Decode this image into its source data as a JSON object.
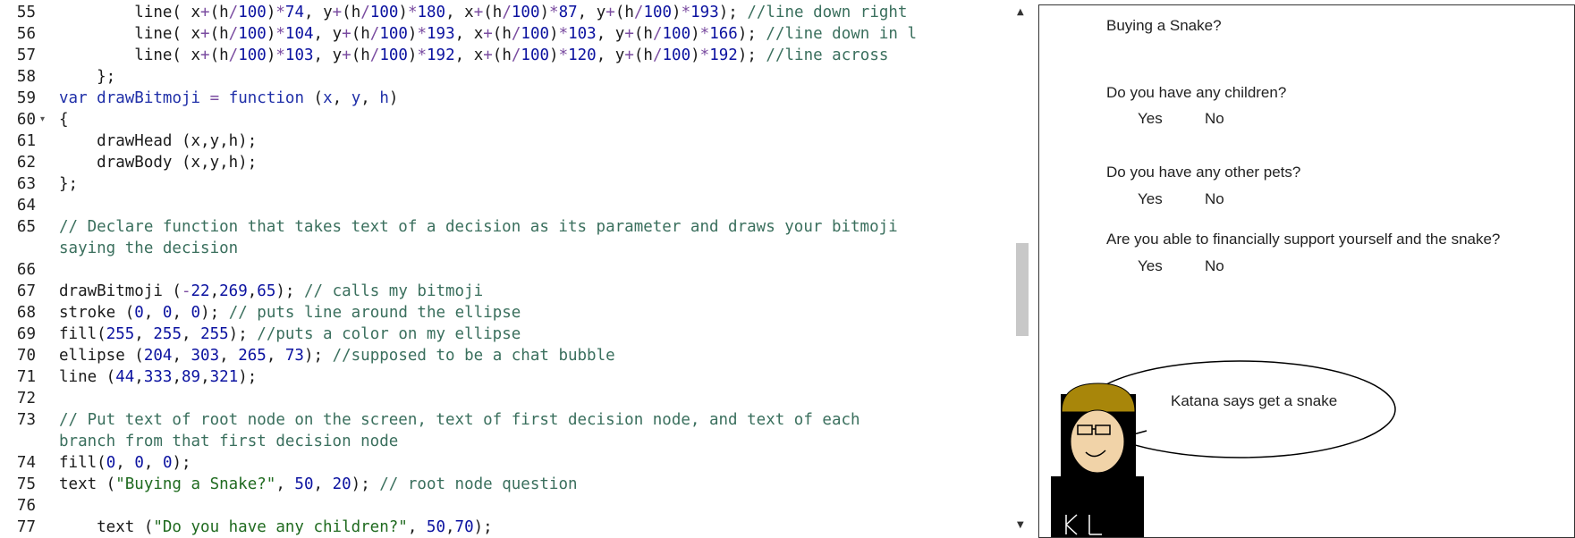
{
  "editor": {
    "lines": [
      {
        "n": "55",
        "fold": "",
        "tokens": [
          {
            "c": "",
            "t": "        line( x"
          },
          {
            "c": "op",
            "t": "+"
          },
          {
            "c": "",
            "t": "(h"
          },
          {
            "c": "op",
            "t": "/"
          },
          {
            "c": "num",
            "t": "100"
          },
          {
            "c": "",
            "t": ")"
          },
          {
            "c": "op",
            "t": "*"
          },
          {
            "c": "num",
            "t": "74"
          },
          {
            "c": "",
            "t": ", y"
          },
          {
            "c": "op",
            "t": "+"
          },
          {
            "c": "",
            "t": "(h"
          },
          {
            "c": "op",
            "t": "/"
          },
          {
            "c": "num",
            "t": "100"
          },
          {
            "c": "",
            "t": ")"
          },
          {
            "c": "op",
            "t": "*"
          },
          {
            "c": "num",
            "t": "180"
          },
          {
            "c": "",
            "t": ", x"
          },
          {
            "c": "op",
            "t": "+"
          },
          {
            "c": "",
            "t": "(h"
          },
          {
            "c": "op",
            "t": "/"
          },
          {
            "c": "num",
            "t": "100"
          },
          {
            "c": "",
            "t": ")"
          },
          {
            "c": "op",
            "t": "*"
          },
          {
            "c": "num",
            "t": "87"
          },
          {
            "c": "",
            "t": ", y"
          },
          {
            "c": "op",
            "t": "+"
          },
          {
            "c": "",
            "t": "(h"
          },
          {
            "c": "op",
            "t": "/"
          },
          {
            "c": "num",
            "t": "100"
          },
          {
            "c": "",
            "t": ")"
          },
          {
            "c": "op",
            "t": "*"
          },
          {
            "c": "num",
            "t": "193"
          },
          {
            "c": "",
            "t": "); "
          },
          {
            "c": "cm",
            "t": "//line down right"
          }
        ]
      },
      {
        "n": "56",
        "fold": "",
        "tokens": [
          {
            "c": "",
            "t": "        line( x"
          },
          {
            "c": "op",
            "t": "+"
          },
          {
            "c": "",
            "t": "(h"
          },
          {
            "c": "op",
            "t": "/"
          },
          {
            "c": "num",
            "t": "100"
          },
          {
            "c": "",
            "t": ")"
          },
          {
            "c": "op",
            "t": "*"
          },
          {
            "c": "num",
            "t": "104"
          },
          {
            "c": "",
            "t": ", y"
          },
          {
            "c": "op",
            "t": "+"
          },
          {
            "c": "",
            "t": "(h"
          },
          {
            "c": "op",
            "t": "/"
          },
          {
            "c": "num",
            "t": "100"
          },
          {
            "c": "",
            "t": ")"
          },
          {
            "c": "op",
            "t": "*"
          },
          {
            "c": "num",
            "t": "193"
          },
          {
            "c": "",
            "t": ", x"
          },
          {
            "c": "op",
            "t": "+"
          },
          {
            "c": "",
            "t": "(h"
          },
          {
            "c": "op",
            "t": "/"
          },
          {
            "c": "num",
            "t": "100"
          },
          {
            "c": "",
            "t": ")"
          },
          {
            "c": "op",
            "t": "*"
          },
          {
            "c": "num",
            "t": "103"
          },
          {
            "c": "",
            "t": ", y"
          },
          {
            "c": "op",
            "t": "+"
          },
          {
            "c": "",
            "t": "(h"
          },
          {
            "c": "op",
            "t": "/"
          },
          {
            "c": "num",
            "t": "100"
          },
          {
            "c": "",
            "t": ")"
          },
          {
            "c": "op",
            "t": "*"
          },
          {
            "c": "num",
            "t": "166"
          },
          {
            "c": "",
            "t": "); "
          },
          {
            "c": "cm",
            "t": "//line down in l"
          }
        ]
      },
      {
        "n": "57",
        "fold": "",
        "tokens": [
          {
            "c": "",
            "t": "        line( x"
          },
          {
            "c": "op",
            "t": "+"
          },
          {
            "c": "",
            "t": "(h"
          },
          {
            "c": "op",
            "t": "/"
          },
          {
            "c": "num",
            "t": "100"
          },
          {
            "c": "",
            "t": ")"
          },
          {
            "c": "op",
            "t": "*"
          },
          {
            "c": "num",
            "t": "103"
          },
          {
            "c": "",
            "t": ", y"
          },
          {
            "c": "op",
            "t": "+"
          },
          {
            "c": "",
            "t": "(h"
          },
          {
            "c": "op",
            "t": "/"
          },
          {
            "c": "num",
            "t": "100"
          },
          {
            "c": "",
            "t": ")"
          },
          {
            "c": "op",
            "t": "*"
          },
          {
            "c": "num",
            "t": "192"
          },
          {
            "c": "",
            "t": ", x"
          },
          {
            "c": "op",
            "t": "+"
          },
          {
            "c": "",
            "t": "(h"
          },
          {
            "c": "op",
            "t": "/"
          },
          {
            "c": "num",
            "t": "100"
          },
          {
            "c": "",
            "t": ")"
          },
          {
            "c": "op",
            "t": "*"
          },
          {
            "c": "num",
            "t": "120"
          },
          {
            "c": "",
            "t": ", y"
          },
          {
            "c": "op",
            "t": "+"
          },
          {
            "c": "",
            "t": "(h"
          },
          {
            "c": "op",
            "t": "/"
          },
          {
            "c": "num",
            "t": "100"
          },
          {
            "c": "",
            "t": ")"
          },
          {
            "c": "op",
            "t": "*"
          },
          {
            "c": "num",
            "t": "192"
          },
          {
            "c": "",
            "t": "); "
          },
          {
            "c": "cm",
            "t": "//line across"
          }
        ]
      },
      {
        "n": "58",
        "fold": "",
        "tokens": [
          {
            "c": "",
            "t": "    };"
          }
        ]
      },
      {
        "n": "59",
        "fold": "",
        "tokens": [
          {
            "c": "kw",
            "t": "var"
          },
          {
            "c": "",
            "t": " "
          },
          {
            "c": "var",
            "t": "drawBitmoji"
          },
          {
            "c": "",
            "t": " "
          },
          {
            "c": "op",
            "t": "="
          },
          {
            "c": "",
            "t": " "
          },
          {
            "c": "kw",
            "t": "function"
          },
          {
            "c": "",
            "t": " ("
          },
          {
            "c": "var",
            "t": "x"
          },
          {
            "c": "",
            "t": ", "
          },
          {
            "c": "var",
            "t": "y"
          },
          {
            "c": "",
            "t": ", "
          },
          {
            "c": "var",
            "t": "h"
          },
          {
            "c": "",
            "t": ")"
          }
        ]
      },
      {
        "n": "60",
        "fold": "▾",
        "tokens": [
          {
            "c": "",
            "t": "{"
          }
        ]
      },
      {
        "n": "61",
        "fold": "",
        "tokens": [
          {
            "c": "",
            "t": "    drawHead (x,y,h);"
          }
        ]
      },
      {
        "n": "62",
        "fold": "",
        "tokens": [
          {
            "c": "",
            "t": "    drawBody (x,y,h);"
          }
        ]
      },
      {
        "n": "63",
        "fold": "",
        "tokens": [
          {
            "c": "",
            "t": "};"
          }
        ]
      },
      {
        "n": "64",
        "fold": "",
        "tokens": []
      },
      {
        "n": "65",
        "fold": "",
        "tokens": [
          {
            "c": "cm",
            "t": "// Declare function that takes text of a decision as its parameter and draws your bitmoji"
          }
        ]
      },
      {
        "n": "",
        "fold": "",
        "tokens": [
          {
            "c": "cm",
            "t": "saying the decision"
          }
        ]
      },
      {
        "n": "66",
        "fold": "",
        "tokens": []
      },
      {
        "n": "67",
        "fold": "",
        "tokens": [
          {
            "c": "",
            "t": "drawBitmoji ("
          },
          {
            "c": "op",
            "t": "-"
          },
          {
            "c": "num",
            "t": "22"
          },
          {
            "c": "",
            "t": ","
          },
          {
            "c": "num",
            "t": "269"
          },
          {
            "c": "",
            "t": ","
          },
          {
            "c": "num",
            "t": "65"
          },
          {
            "c": "",
            "t": "); "
          },
          {
            "c": "cm",
            "t": "// calls my bitmoji"
          }
        ]
      },
      {
        "n": "68",
        "fold": "",
        "tokens": [
          {
            "c": "",
            "t": "stroke ("
          },
          {
            "c": "num",
            "t": "0"
          },
          {
            "c": "",
            "t": ", "
          },
          {
            "c": "num",
            "t": "0"
          },
          {
            "c": "",
            "t": ", "
          },
          {
            "c": "num",
            "t": "0"
          },
          {
            "c": "",
            "t": "); "
          },
          {
            "c": "cm",
            "t": "// puts line around the ellipse"
          }
        ]
      },
      {
        "n": "69",
        "fold": "",
        "tokens": [
          {
            "c": "",
            "t": "fill("
          },
          {
            "c": "num",
            "t": "255"
          },
          {
            "c": "",
            "t": ", "
          },
          {
            "c": "num",
            "t": "255"
          },
          {
            "c": "",
            "t": ", "
          },
          {
            "c": "num",
            "t": "255"
          },
          {
            "c": "",
            "t": "); "
          },
          {
            "c": "cm",
            "t": "//puts a color on my ellipse"
          }
        ]
      },
      {
        "n": "70",
        "fold": "",
        "tokens": [
          {
            "c": "",
            "t": "ellipse ("
          },
          {
            "c": "num",
            "t": "204"
          },
          {
            "c": "",
            "t": ", "
          },
          {
            "c": "num",
            "t": "303"
          },
          {
            "c": "",
            "t": ", "
          },
          {
            "c": "num",
            "t": "265"
          },
          {
            "c": "",
            "t": ", "
          },
          {
            "c": "num",
            "t": "73"
          },
          {
            "c": "",
            "t": "); "
          },
          {
            "c": "cm",
            "t": "//supposed to be a chat bubble"
          }
        ]
      },
      {
        "n": "71",
        "fold": "",
        "tokens": [
          {
            "c": "",
            "t": "line ("
          },
          {
            "c": "num",
            "t": "44"
          },
          {
            "c": "",
            "t": ","
          },
          {
            "c": "num",
            "t": "333"
          },
          {
            "c": "",
            "t": ","
          },
          {
            "c": "num",
            "t": "89"
          },
          {
            "c": "",
            "t": ","
          },
          {
            "c": "num",
            "t": "321"
          },
          {
            "c": "",
            "t": ");"
          }
        ]
      },
      {
        "n": "72",
        "fold": "",
        "tokens": []
      },
      {
        "n": "73",
        "fold": "",
        "tokens": [
          {
            "c": "cm",
            "t": "// Put text of root node on the screen, text of first decision node, and text of each"
          }
        ]
      },
      {
        "n": "",
        "fold": "",
        "tokens": [
          {
            "c": "cm",
            "t": "branch from that first decision node"
          }
        ]
      },
      {
        "n": "74",
        "fold": "",
        "tokens": [
          {
            "c": "",
            "t": "fill("
          },
          {
            "c": "num",
            "t": "0"
          },
          {
            "c": "",
            "t": ", "
          },
          {
            "c": "num",
            "t": "0"
          },
          {
            "c": "",
            "t": ", "
          },
          {
            "c": "num",
            "t": "0"
          },
          {
            "c": "",
            "t": ");"
          }
        ]
      },
      {
        "n": "75",
        "fold": "",
        "tokens": [
          {
            "c": "",
            "t": "text ("
          },
          {
            "c": "str",
            "t": "\"Buying a Snake?\""
          },
          {
            "c": "",
            "t": ", "
          },
          {
            "c": "num",
            "t": "50"
          },
          {
            "c": "",
            "t": ", "
          },
          {
            "c": "num",
            "t": "20"
          },
          {
            "c": "",
            "t": "); "
          },
          {
            "c": "cm",
            "t": "// root node question"
          }
        ]
      },
      {
        "n": "76",
        "fold": "",
        "tokens": []
      },
      {
        "n": "77",
        "fold": "",
        "tokens": [
          {
            "c": "",
            "t": "    text ("
          },
          {
            "c": "str",
            "t": "\"Do you have any children?\""
          },
          {
            "c": "",
            "t": ", "
          },
          {
            "c": "num",
            "t": "50"
          },
          {
            "c": "",
            "t": ","
          },
          {
            "c": "num",
            "t": "70"
          },
          {
            "c": "",
            "t": ");"
          }
        ]
      }
    ]
  },
  "scrollbar": {
    "up_arrow": "▲",
    "down_arrow": "▼"
  },
  "canvas": {
    "root_question": "Buying a Snake?",
    "q1": "Do you have any children?",
    "q1_yes": "Yes",
    "q1_no": "No",
    "q2": "Do you have any other pets?",
    "q2_yes": "Yes",
    "q2_no": "No",
    "q3": "Are you able to financially support yourself and the snake?",
    "q3_yes": "Yes",
    "q3_no": "No",
    "speech": "Katana says get a snake",
    "shirt_initials": "K L"
  },
  "colors": {
    "hair": "#a8860a",
    "skin": "#f1d3a8",
    "shirt": "#000000",
    "hair_dark": "#000000"
  }
}
